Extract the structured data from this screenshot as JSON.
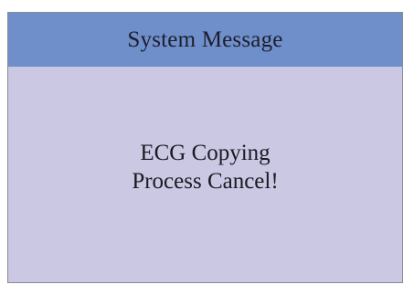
{
  "dialog": {
    "title": "System Message",
    "message_lines": [
      "ECG Copying",
      "Process Cancel!"
    ]
  },
  "colors": {
    "title_bar": "#6f8fcb",
    "dialog_background": "#cbc8e4",
    "border": "#8a8a96",
    "text": "#1e1e2a"
  }
}
